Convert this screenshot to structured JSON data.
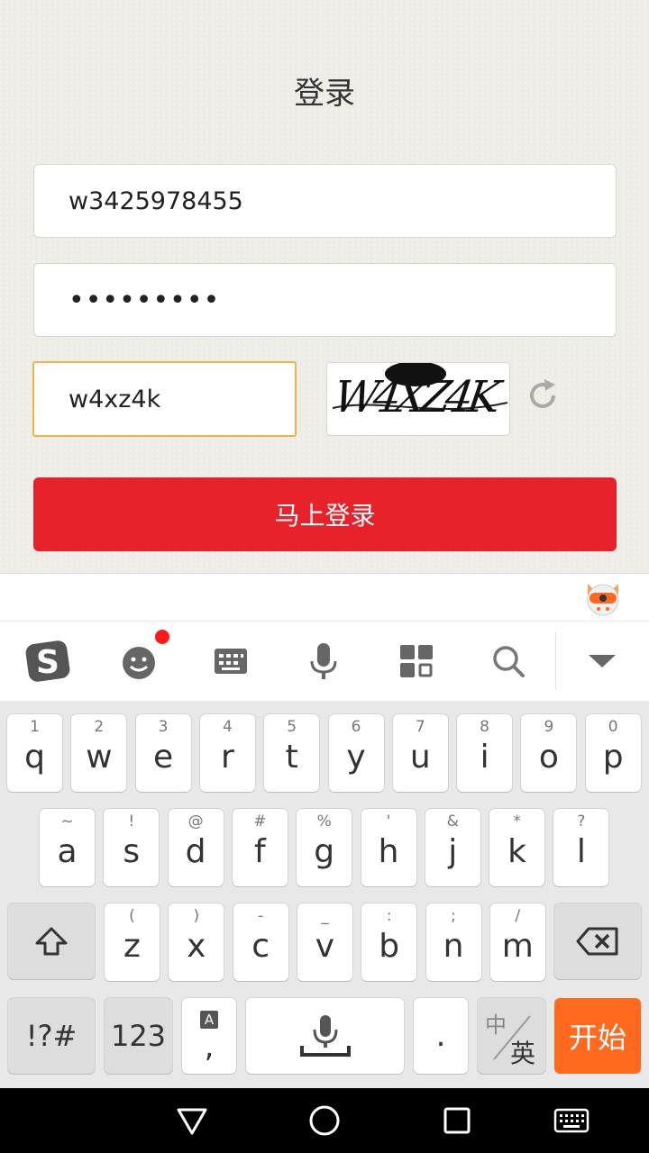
{
  "login": {
    "title": "登录",
    "username_value": "w3425978455",
    "password_value": "•••••••••",
    "captcha_input_value": "w4xz4k",
    "captcha_image_text": "W4XZ4K",
    "submit_label": "马上登录"
  },
  "toolbar": {
    "icons": [
      "sogou-logo-icon",
      "emoji-icon",
      "keyboard-icon",
      "microphone-icon",
      "apps-grid-icon",
      "search-icon",
      "collapse-icon"
    ]
  },
  "keyboard": {
    "row1": [
      {
        "key": "q",
        "hint": "1"
      },
      {
        "key": "w",
        "hint": "2"
      },
      {
        "key": "e",
        "hint": "3"
      },
      {
        "key": "r",
        "hint": "4"
      },
      {
        "key": "t",
        "hint": "5"
      },
      {
        "key": "y",
        "hint": "6"
      },
      {
        "key": "u",
        "hint": "7"
      },
      {
        "key": "i",
        "hint": "8"
      },
      {
        "key": "o",
        "hint": "9"
      },
      {
        "key": "p",
        "hint": "0"
      }
    ],
    "row2": [
      {
        "key": "a",
        "hint": "~"
      },
      {
        "key": "s",
        "hint": "!"
      },
      {
        "key": "d",
        "hint": "@"
      },
      {
        "key": "f",
        "hint": "#"
      },
      {
        "key": "g",
        "hint": "%"
      },
      {
        "key": "h",
        "hint": "'"
      },
      {
        "key": "j",
        "hint": "&"
      },
      {
        "key": "k",
        "hint": "*"
      },
      {
        "key": "l",
        "hint": "?"
      }
    ],
    "row3": [
      {
        "key": "z",
        "hint": "("
      },
      {
        "key": "x",
        "hint": ")"
      },
      {
        "key": "c",
        "hint": "-"
      },
      {
        "key": "v",
        "hint": "_"
      },
      {
        "key": "b",
        "hint": ":"
      },
      {
        "key": "n",
        "hint": ";"
      },
      {
        "key": "m",
        "hint": "/"
      }
    ],
    "symbols_label": "!?#",
    "numbers_label": "123",
    "comma_hint": "A",
    "comma_label": ",",
    "period_label": ".",
    "lang_top": "中",
    "lang_bottom": "英",
    "go_label": "开始"
  },
  "colors": {
    "accent_red": "#e8222b",
    "focus_orange": "#f0b34a",
    "go_orange": "#ff6a1f",
    "notification_dot": "#ff1a1a"
  }
}
